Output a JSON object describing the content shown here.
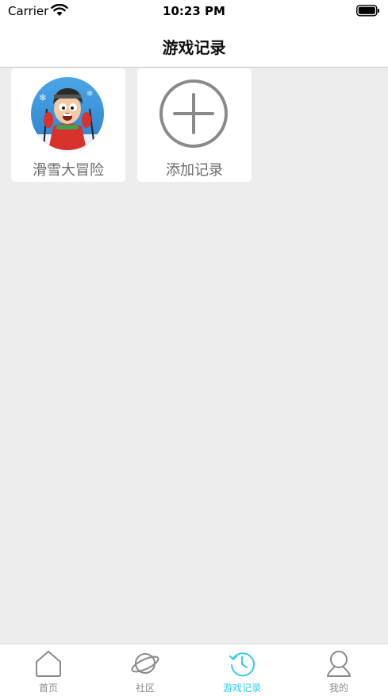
{
  "status_bar": {
    "carrier": "Carrier",
    "time": "10:23 PM",
    "wifi_icon": "wifi-icon",
    "battery_icon": "battery-icon"
  },
  "nav": {
    "title": "游戏记录"
  },
  "records": [
    {
      "label": "滑雪大冒险",
      "icon": "game-cover-image"
    },
    {
      "label": "添加记录",
      "icon": "plus-circle-icon"
    }
  ],
  "tabs": [
    {
      "label": "首页",
      "icon": "home-icon",
      "active": false
    },
    {
      "label": "社区",
      "icon": "planet-icon",
      "active": false
    },
    {
      "label": "游戏记录",
      "icon": "history-clock-icon",
      "active": true
    },
    {
      "label": "我的",
      "icon": "user-icon",
      "active": false
    }
  ],
  "colors": {
    "active_tab": "#33ccea",
    "inactive_tab": "#8a8a8a",
    "background": "#ededed"
  }
}
